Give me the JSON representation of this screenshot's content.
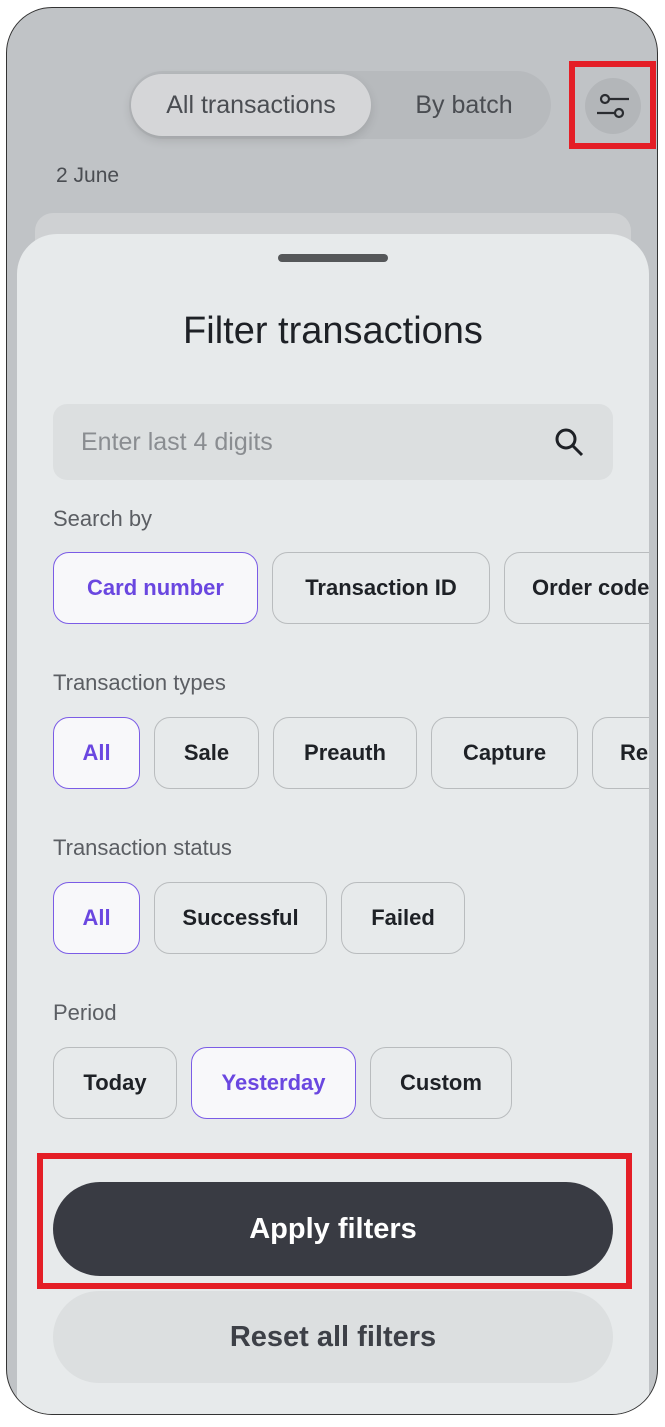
{
  "header": {
    "tabs": [
      {
        "label": "All transactions",
        "selected": true
      },
      {
        "label": "By batch",
        "selected": false
      }
    ],
    "filter_icon": "sliders-icon"
  },
  "list": {
    "date": "2 June"
  },
  "sheet": {
    "title": "Filter transactions",
    "search": {
      "placeholder": "Enter last 4 digits",
      "value": "",
      "icon": "search-icon"
    },
    "search_by": {
      "label": "Search by",
      "options": [
        "Card number",
        "Transaction ID",
        "Order code"
      ],
      "selected": "Card number"
    },
    "types": {
      "label": "Transaction types",
      "options": [
        "All",
        "Sale",
        "Preauth",
        "Capture",
        "Re"
      ],
      "selected": "All"
    },
    "status": {
      "label": "Transaction status",
      "options": [
        "All",
        "Successful",
        "Failed"
      ],
      "selected": "All"
    },
    "period": {
      "label": "Period",
      "options": [
        "Today",
        "Yesterday",
        "Custom"
      ],
      "selected": "Yesterday"
    },
    "apply_label": "Apply filters",
    "reset_label": "Reset all filters"
  },
  "colors": {
    "accent": "#6a47e0",
    "primary_button": "#393b43",
    "highlight": "#e41e26"
  }
}
